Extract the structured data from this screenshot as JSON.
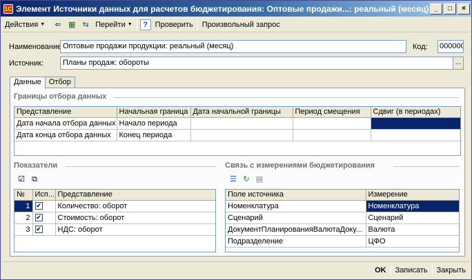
{
  "window": {
    "title": "Элемент Источники данных для расчетов бюджетирования: Оптовые продажи...: реальный (месяц)",
    "minimize": "_",
    "maximize": "□",
    "close": "×"
  },
  "toolbar": {
    "actions_label": "Действия",
    "goto_label": "Перейти",
    "help_icon": "?",
    "check_label": "Проверить",
    "query_label": "Произвольный запрос"
  },
  "form": {
    "name_label": "Наименование:",
    "name_value": "Оптовые продажи продукции: реальный (месяц)",
    "code_label": "Код:",
    "code_value": "000000",
    "source_label": "Источник:",
    "source_value": "Планы продаж: обороты",
    "ellipsis": "..."
  },
  "tabs": [
    {
      "label": "Данные"
    },
    {
      "label": "Отбор"
    }
  ],
  "bounds": {
    "title": "Границы отбора данных",
    "columns": [
      "Представление",
      "Начальная граница",
      "Дата начальной границы",
      "Период смещения",
      "Сдвиг (в периодах)"
    ],
    "rows": [
      [
        "Дата начала отбора данных",
        "Начало периода",
        "",
        "",
        ""
      ],
      [
        "Дата конца отбора данных",
        "Конец периода",
        "",
        "",
        ""
      ]
    ]
  },
  "indicators": {
    "title": "Показатели",
    "columns": [
      "№",
      "Исп...",
      "Представление"
    ],
    "rows": [
      {
        "num": "1",
        "checked": "✔",
        "name": "Количество: оборот"
      },
      {
        "num": "2",
        "checked": "✔",
        "name": "Стоимость: оборот"
      },
      {
        "num": "3",
        "checked": "✔",
        "name": "НДС: оборот"
      }
    ]
  },
  "links": {
    "title": "Связь с измерениями бюджетирования",
    "columns": [
      "Поле источника",
      "Измерение"
    ],
    "rows": [
      [
        "Номенклатура",
        "Номенклатура"
      ],
      [
        "Сценарий",
        "Сценарий"
      ],
      [
        "ДокументПланированияВалютаДоку...",
        "Валюта"
      ],
      [
        "Подразделение",
        "ЦФО"
      ]
    ]
  },
  "bottom": {
    "ok_label": "OK",
    "save_label": "Записать",
    "close_label": "Закрыть"
  }
}
